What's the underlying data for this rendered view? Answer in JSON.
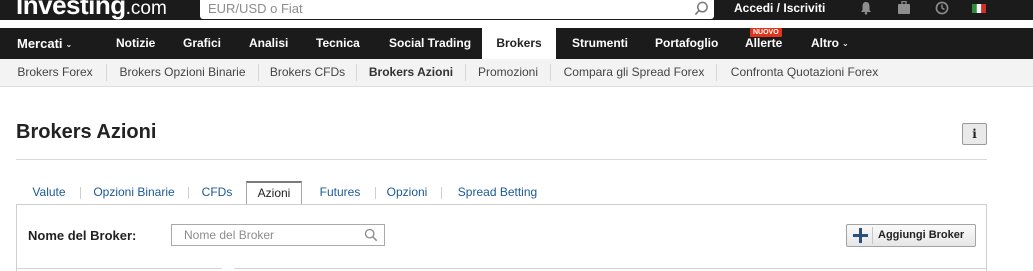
{
  "logo": {
    "bold": "Investing",
    "light": ".com"
  },
  "search": {
    "placeholder": "EUR/USD o Fiat"
  },
  "login": {
    "label": "Accedi / Iscriviti"
  },
  "main_nav": {
    "items": [
      {
        "label": "Mercati"
      },
      {
        "label": "Notizie"
      },
      {
        "label": "Grafici"
      },
      {
        "label": "Analisi"
      },
      {
        "label": "Tecnica"
      },
      {
        "label": "Social Trading"
      },
      {
        "label": "Brokers"
      },
      {
        "label": "Strumenti"
      },
      {
        "label": "Portafoglio"
      },
      {
        "label": "Allerte"
      },
      {
        "label": "Altro"
      }
    ],
    "badge": "NUOVO",
    "chevron": "⌄"
  },
  "sub_nav": {
    "items": [
      {
        "label": "Brokers Forex"
      },
      {
        "label": "Brokers Opzioni Binarie"
      },
      {
        "label": "Brokers CFDs"
      },
      {
        "label": "Brokers Azioni"
      },
      {
        "label": "Promozioni"
      },
      {
        "label": "Compara gli Spread Forex"
      },
      {
        "label": "Confronta Quotazioni Forex"
      }
    ]
  },
  "page": {
    "title": "Brokers Azioni",
    "info_label": "i"
  },
  "tabs": {
    "items": [
      {
        "label": "Valute"
      },
      {
        "label": "Opzioni Binarie"
      },
      {
        "label": "CFDs"
      },
      {
        "label": "Azioni"
      },
      {
        "label": "Futures"
      },
      {
        "label": "Opzioni"
      },
      {
        "label": "Spread Betting"
      }
    ]
  },
  "filter": {
    "label": "Nome del Broker:",
    "placeholder": "Nome del Broker",
    "add_button": "Aggiungi Broker"
  },
  "colors": {
    "topbar": "#1b1b1b",
    "badge": "#e2341d",
    "tab_link": "#1a5a97",
    "plus_icon": "#2d4f7c"
  },
  "icons": [
    "search-icon",
    "bell-icon",
    "briefcase-icon",
    "clock-icon",
    "italy-flag-icon",
    "info-icon",
    "plus-icon"
  ]
}
